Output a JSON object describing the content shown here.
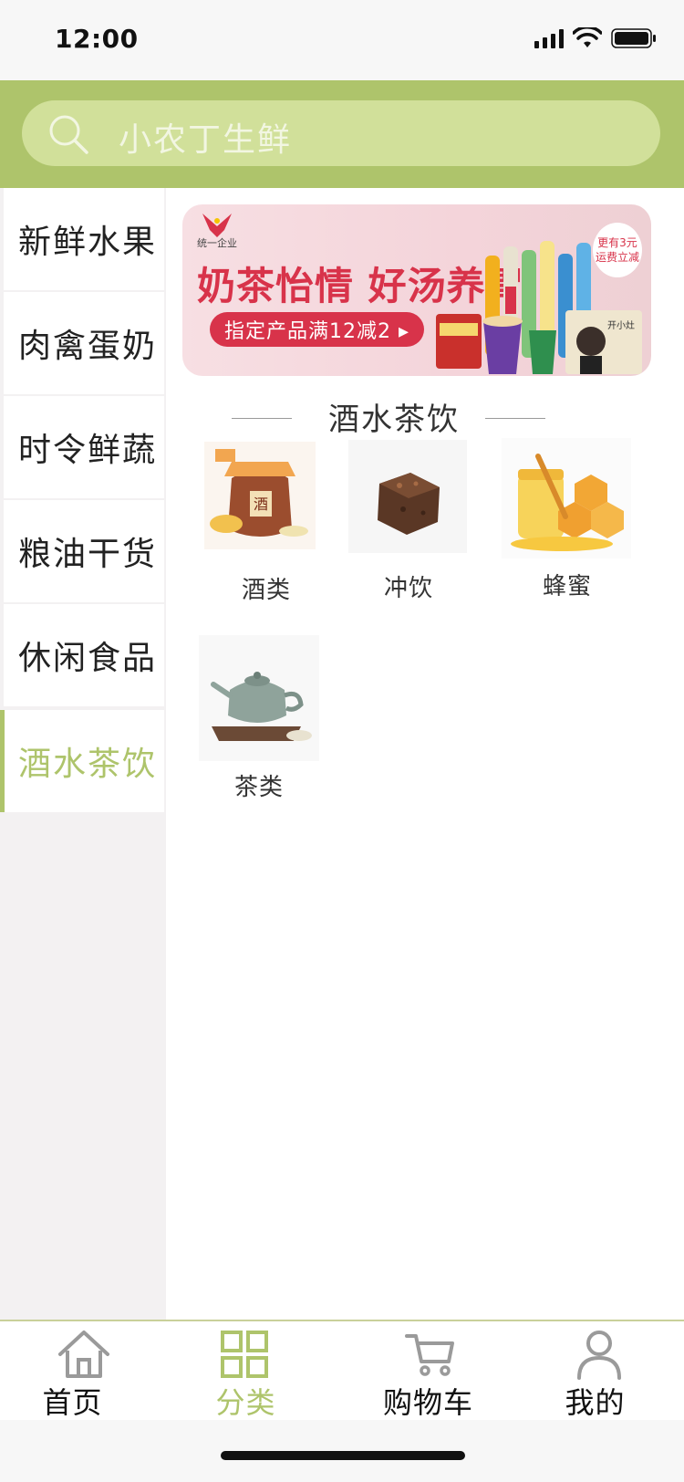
{
  "status_bar": {
    "time": "12:00"
  },
  "search": {
    "text": "小农丁生鲜"
  },
  "sidebar": {
    "items": [
      {
        "label": "新鲜水果"
      },
      {
        "label": "肉禽蛋奶"
      },
      {
        "label": "时令鲜蔬"
      },
      {
        "label": "粮油干货"
      },
      {
        "label": "休闲食品"
      },
      {
        "label": "酒水茶饮"
      }
    ],
    "active_label": "酒水茶饮"
  },
  "banner": {
    "brand": "统一企业",
    "title": "奶茶怡情 好汤养胃",
    "promo": "指定产品满12减2 ▸",
    "note_line1": "更有3元",
    "note_line2": "运费立减"
  },
  "section": {
    "title": "酒水茶饮"
  },
  "categories": [
    {
      "label": "酒类",
      "icon": "liquor-jar-image"
    },
    {
      "label": "冲饮",
      "icon": "brown-sugar-cube-image"
    },
    {
      "label": "蜂蜜",
      "icon": "honey-image"
    },
    {
      "label": "茶类",
      "icon": "teapot-image"
    }
  ],
  "tabbar": {
    "tabs": [
      {
        "label": "首页",
        "icon": "home-icon"
      },
      {
        "label": "分类",
        "icon": "category-grid-icon"
      },
      {
        "label": "购物车",
        "icon": "cart-icon"
      },
      {
        "label": "我的",
        "icon": "user-icon"
      }
    ],
    "active_index": 1
  },
  "colors": {
    "accent": "#aec46b",
    "search_bg": "#d1e09a",
    "sidebar_bg": "#f3f1f2",
    "banner_red": "#d8334a"
  }
}
